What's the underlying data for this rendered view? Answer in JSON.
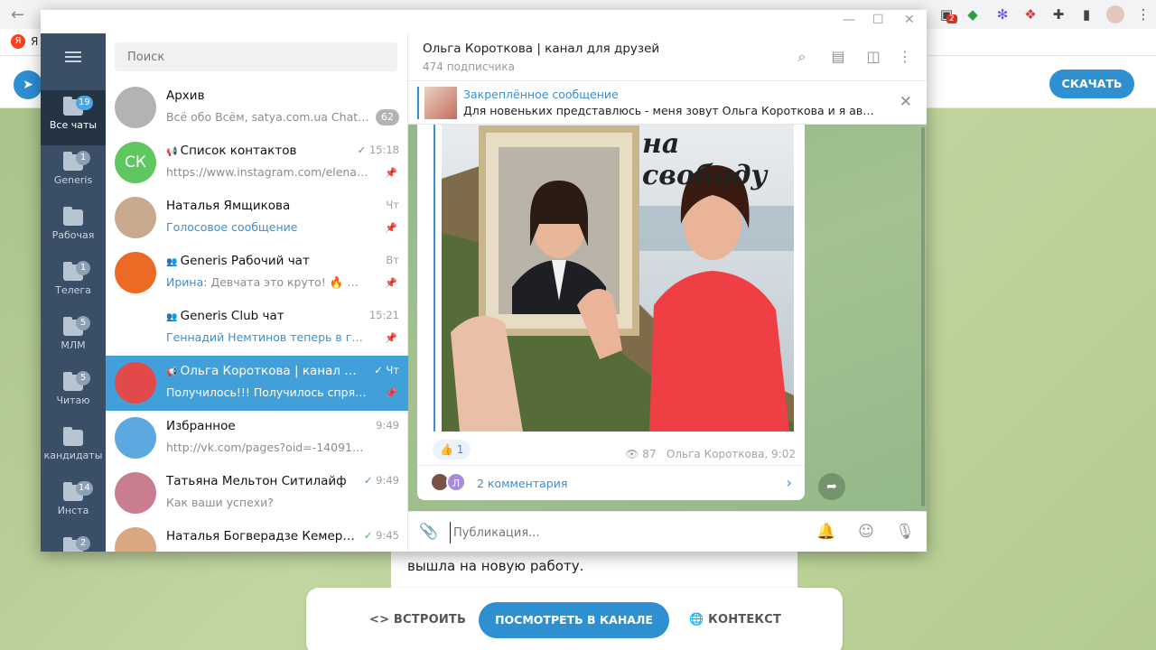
{
  "browser": {
    "bookmark_letter": "Я",
    "bookmark_text": "Я",
    "ext_badge": "2"
  },
  "background_page": {
    "download_label": "СКАЧАТЬ",
    "card_text": "вышла на новую работу.",
    "actions": {
      "embed": "ВСТРОИТЬ",
      "view_in_channel": "ПОСМОТРЕТЬ В КАНАЛЕ",
      "context": "КОНТЕКСТ"
    }
  },
  "folders": [
    {
      "label": "Все чаты",
      "badge": "19",
      "active": true
    },
    {
      "label": "Generis",
      "badge": "1"
    },
    {
      "label": "Рабочая",
      "badge": ""
    },
    {
      "label": "Телега",
      "badge": "1"
    },
    {
      "label": "МЛМ",
      "badge": "5"
    },
    {
      "label": "Читаю",
      "badge": "5"
    },
    {
      "label": "кандидаты",
      "badge": ""
    },
    {
      "label": "Инста",
      "badge": "14"
    },
    {
      "label": "",
      "badge": "2"
    }
  ],
  "search": {
    "placeholder": "Поиск"
  },
  "chats": [
    {
      "title": "Архив",
      "preview": "Всё обо Всём, satya.com.ua Chat, ...",
      "time": "",
      "count": "62",
      "avatar_text": "",
      "avatar_color": "#b3b3b3"
    },
    {
      "title": "Список контактов",
      "preview": "https://www.instagram.com/elena.no...",
      "time": "15:18",
      "avatar_text": "СК",
      "avatar_color": "#5fc75f",
      "icon": "megaphone"
    },
    {
      "title": "Наталья Ямщикова",
      "preview": "Голосовое сообщение",
      "time": "Чт",
      "avatar_text": "",
      "avatar_color": "#c9a98d"
    },
    {
      "title": "Generis Рабочий чат",
      "preview_sender": "Ирина:",
      "preview": "Девчата это круто! 🔥 🔥 🔥",
      "time": "Вт",
      "avatar_text": "",
      "avatar_color": "#ec6a23",
      "icon": "group"
    },
    {
      "title": "Generis Club чат",
      "preview": "Геннадий Немтинов теперь в группе",
      "time": "15:21",
      "avatar_text": "",
      "avatar_color": "#ffffff",
      "icon": "group"
    },
    {
      "title": "Ольга Короткова | канал дл...",
      "preview": "Получилось!!! Получилось спрятать...",
      "time": "Чт",
      "avatar_text": "",
      "avatar_color": "#e24a4a",
      "icon": "megaphone",
      "active": true
    },
    {
      "title": "Избранное",
      "preview": "http://vk.com/pages?oid=-140917506&p=...",
      "time": "9:49",
      "avatar_text": "",
      "avatar_color": "#5ca8e0"
    },
    {
      "title": "Татьяна Мельтон Ситилайф",
      "preview": "Как ваши успехи?",
      "time": "9:49",
      "avatar_text": "",
      "avatar_color": "#c97d8f"
    },
    {
      "title": "Наталья Богверадзе Кемерово",
      "preview": "",
      "time": "9:45",
      "avatar_text": "",
      "avatar_color": "#d9a882"
    }
  ],
  "conversation": {
    "title": "Ольга Короткова | канал для друзей",
    "subtitle": "474 подписчика",
    "pinned_label": "Закреплённое сообщение",
    "pinned_text": "Для новеньких представлюсь - меня зовут Ольга Короткова и я автор э...",
    "photo_caption": "на свободу",
    "reaction_emoji": "👍",
    "reaction_count": "1",
    "views": "87",
    "author_time": "Ольга Короткова, 9:02",
    "comments_label": "2 комментария",
    "comment_avatar_letter": "Л",
    "composer_placeholder": "Публикация..."
  }
}
